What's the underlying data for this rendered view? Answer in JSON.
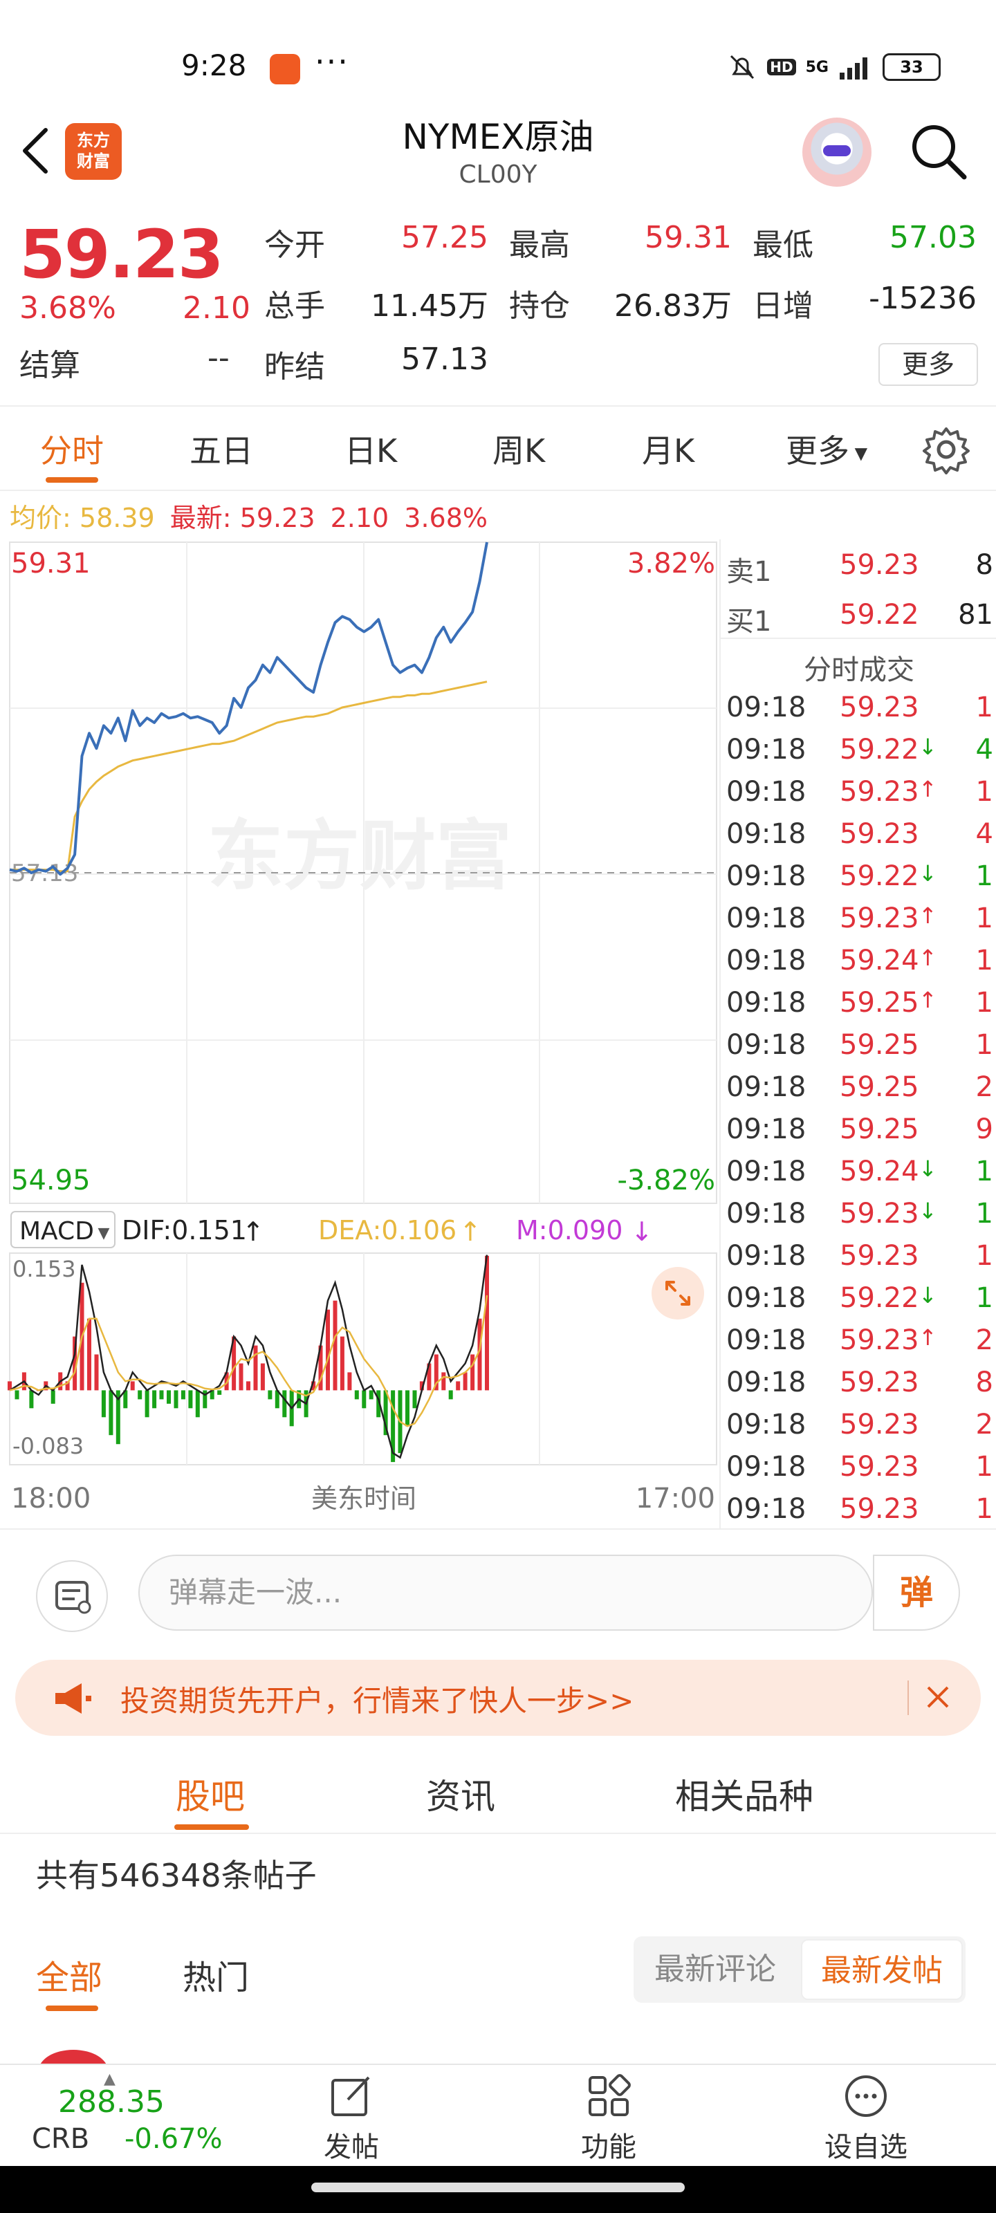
{
  "status": {
    "time": "9:28",
    "dots": "···",
    "net": "5G",
    "hd": "HD",
    "battery": "33"
  },
  "header": {
    "logo_text": "东方\n财富",
    "title": "NYMEX原油",
    "code": "CL00Y"
  },
  "quote": {
    "price": "59.23",
    "change_pct": "3.68%",
    "change": "2.10",
    "settle_label": "结算",
    "settle_value": "--",
    "fields": [
      {
        "label": "今开",
        "value": "57.25",
        "color": "red"
      },
      {
        "label": "最高",
        "value": "59.31",
        "color": "red"
      },
      {
        "label": "最低",
        "value": "57.03",
        "color": "green"
      },
      {
        "label": "总手",
        "value": "11.45万",
        "color": "black"
      },
      {
        "label": "持仓",
        "value": "26.83万",
        "color": "black"
      },
      {
        "label": "日增",
        "value": "-15236",
        "color": "black"
      },
      {
        "label": "昨结",
        "value": "57.13",
        "color": "black"
      }
    ],
    "more_label": "更多"
  },
  "chart_tabs": {
    "items": [
      "分时",
      "五日",
      "日K",
      "周K",
      "月K",
      "更多"
    ],
    "active": "分时"
  },
  "info_line": {
    "avg_label": "均价:",
    "avg_value": "58.39",
    "last_label": "最新:",
    "last_value": "59.23",
    "change": "2.10",
    "change_pct": "3.68%"
  },
  "chart_data": [
    {
      "type": "line",
      "name": "price",
      "ylim": [
        54.95,
        59.31
      ],
      "y_top_label": "59.31",
      "y_bottom_label": "54.95",
      "y_top_pct": "3.82%",
      "y_bottom_pct": "-3.82%",
      "ref_value": 57.13,
      "ref_label": "57.13",
      "watermark": "东方财富",
      "xlabel": "美东时间",
      "x_start": "18:00",
      "x_end": "17:00",
      "series": [
        {
          "values": [
            57.15,
            57.14,
            57.16,
            57.13,
            57.15,
            57.14,
            57.17,
            57.12,
            57.16,
            57.25,
            57.9,
            58.05,
            57.95,
            58.1,
            58.05,
            58.15,
            58.0,
            58.2,
            58.1,
            58.15,
            58.12,
            58.18,
            58.15,
            58.16,
            58.18,
            58.15,
            58.16,
            58.14,
            58.12,
            58.05,
            58.1,
            58.28,
            58.22,
            58.35,
            58.4,
            58.5,
            58.45,
            58.55,
            58.5,
            58.45,
            58.4,
            58.35,
            58.32,
            58.5,
            58.65,
            58.78,
            58.82,
            58.8,
            58.75,
            58.72,
            58.75,
            58.8,
            58.65,
            58.5,
            58.45,
            58.48,
            58.5,
            58.45,
            58.55,
            58.68,
            58.75,
            58.65,
            58.72,
            58.78,
            58.85,
            59.05,
            59.31
          ]
        },
        {
          "values": [
            57.15,
            57.15,
            57.15,
            57.15,
            57.15,
            57.15,
            57.15,
            57.14,
            57.14,
            57.5,
            57.6,
            57.68,
            57.73,
            57.77,
            57.8,
            57.83,
            57.85,
            57.87,
            57.88,
            57.89,
            57.9,
            57.91,
            57.92,
            57.93,
            57.94,
            57.95,
            57.96,
            57.97,
            57.98,
            57.98,
            57.99,
            58.0,
            58.02,
            58.04,
            58.06,
            58.08,
            58.1,
            58.12,
            58.13,
            58.14,
            58.15,
            58.16,
            58.16,
            58.17,
            58.18,
            58.2,
            58.22,
            58.23,
            58.24,
            58.25,
            58.26,
            58.27,
            58.28,
            58.29,
            58.29,
            58.3,
            58.3,
            58.31,
            58.31,
            58.32,
            58.33,
            58.34,
            58.35,
            58.36,
            58.37,
            58.38,
            58.39
          ]
        }
      ]
    },
    {
      "type": "bar",
      "name": "MACD",
      "selector": "MACD",
      "dif": "DIF:0.151",
      "dea": "DEA:0.106",
      "m": "M:0.090",
      "ylim": [
        -0.083,
        0.153
      ],
      "y_top_label": "0.153",
      "y_bottom_label": "-0.083",
      "series": [
        {
          "name": "M",
          "values": [
            0.01,
            -0.01,
            0.02,
            -0.02,
            0.0,
            0.01,
            -0.015,
            0.02,
            0.01,
            0.06,
            0.12,
            0.08,
            0.04,
            -0.03,
            -0.05,
            -0.06,
            -0.02,
            0.01,
            -0.01,
            -0.03,
            -0.02,
            -0.01,
            -0.015,
            -0.02,
            -0.01,
            -0.02,
            -0.03,
            -0.02,
            -0.01,
            -0.005,
            0.02,
            0.06,
            0.03,
            0.01,
            0.05,
            0.03,
            -0.01,
            -0.02,
            -0.03,
            -0.04,
            -0.02,
            -0.03,
            0.01,
            0.05,
            0.09,
            0.1,
            0.06,
            0.02,
            -0.01,
            -0.02,
            -0.01,
            -0.03,
            -0.05,
            -0.08,
            -0.07,
            -0.04,
            -0.02,
            0.01,
            0.03,
            0.04,
            0.02,
            -0.01,
            0.01,
            0.02,
            0.04,
            0.08,
            0.15
          ]
        },
        {
          "name": "DIF",
          "values": [
            0.0,
            0.005,
            0.01,
            0.0,
            -0.005,
            0.005,
            0.0,
            0.01,
            0.015,
            0.04,
            0.14,
            0.11,
            0.07,
            0.02,
            0.0,
            -0.01,
            0.0,
            0.02,
            0.01,
            0.0,
            0.005,
            0.01,
            0.008,
            0.005,
            0.01,
            0.005,
            0.0,
            -0.005,
            0.0,
            0.005,
            0.02,
            0.06,
            0.05,
            0.03,
            0.06,
            0.05,
            0.02,
            0.0,
            -0.01,
            -0.02,
            -0.01,
            -0.015,
            0.01,
            0.05,
            0.1,
            0.12,
            0.09,
            0.05,
            0.02,
            0.0,
            0.005,
            -0.01,
            -0.04,
            -0.07,
            -0.075,
            -0.05,
            -0.03,
            0.0,
            0.03,
            0.05,
            0.035,
            0.01,
            0.02,
            0.03,
            0.05,
            0.09,
            0.151
          ]
        },
        {
          "name": "DEA",
          "values": [
            0.0,
            0.002,
            0.005,
            0.004,
            0.0,
            0.002,
            0.002,
            0.005,
            0.008,
            0.02,
            0.06,
            0.08,
            0.08,
            0.06,
            0.04,
            0.02,
            0.01,
            0.012,
            0.012,
            0.008,
            0.007,
            0.008,
            0.008,
            0.007,
            0.008,
            0.007,
            0.005,
            0.002,
            0.001,
            0.002,
            0.008,
            0.025,
            0.035,
            0.033,
            0.04,
            0.043,
            0.035,
            0.025,
            0.012,
            0.0,
            -0.003,
            -0.006,
            -0.002,
            0.012,
            0.035,
            0.06,
            0.07,
            0.065,
            0.05,
            0.035,
            0.025,
            0.015,
            0.0,
            -0.02,
            -0.035,
            -0.04,
            -0.037,
            -0.025,
            -0.01,
            0.008,
            0.015,
            0.014,
            0.016,
            0.02,
            0.028,
            0.045,
            0.106
          ]
        }
      ]
    }
  ],
  "orderbook": {
    "ask_label": "卖1",
    "ask_price": "59.23",
    "ask_vol": "8",
    "bid_label": "买1",
    "bid_price": "59.22",
    "bid_vol": "81",
    "ticks_title": "分时成交",
    "ticks": [
      {
        "time": "09:18",
        "price": "59.23",
        "arrow": "",
        "vol": "1"
      },
      {
        "time": "09:18",
        "price": "59.22",
        "arrow": "↓",
        "vol": "4"
      },
      {
        "time": "09:18",
        "price": "59.23",
        "arrow": "↑",
        "vol": "1"
      },
      {
        "time": "09:18",
        "price": "59.23",
        "arrow": "",
        "vol": "4"
      },
      {
        "time": "09:18",
        "price": "59.22",
        "arrow": "↓",
        "vol": "1"
      },
      {
        "time": "09:18",
        "price": "59.23",
        "arrow": "↑",
        "vol": "1"
      },
      {
        "time": "09:18",
        "price": "59.24",
        "arrow": "↑",
        "vol": "1"
      },
      {
        "time": "09:18",
        "price": "59.25",
        "arrow": "↑",
        "vol": "1"
      },
      {
        "time": "09:18",
        "price": "59.25",
        "arrow": "",
        "vol": "1"
      },
      {
        "time": "09:18",
        "price": "59.25",
        "arrow": "",
        "vol": "2"
      },
      {
        "time": "09:18",
        "price": "59.25",
        "arrow": "",
        "vol": "9"
      },
      {
        "time": "09:18",
        "price": "59.24",
        "arrow": "↓",
        "vol": "1"
      },
      {
        "time": "09:18",
        "price": "59.23",
        "arrow": "↓",
        "vol": "1"
      },
      {
        "time": "09:18",
        "price": "59.23",
        "arrow": "",
        "vol": "1"
      },
      {
        "time": "09:18",
        "price": "59.22",
        "arrow": "↓",
        "vol": "1"
      },
      {
        "time": "09:18",
        "price": "59.23",
        "arrow": "↑",
        "vol": "2"
      },
      {
        "time": "09:18",
        "price": "59.23",
        "arrow": "",
        "vol": "8"
      },
      {
        "time": "09:18",
        "price": "59.23",
        "arrow": "",
        "vol": "2"
      },
      {
        "time": "09:18",
        "price": "59.23",
        "arrow": "",
        "vol": "1"
      },
      {
        "time": "09:18",
        "price": "59.23",
        "arrow": "",
        "vol": "1"
      }
    ]
  },
  "danmu": {
    "placeholder": "弹幕走一波...",
    "send_label": "弹"
  },
  "banner": {
    "text": "投资期货先开户，行情来了快人一步>>"
  },
  "section_tabs": {
    "items": [
      "股吧",
      "资讯",
      "相关品种"
    ],
    "active": "股吧"
  },
  "post_count": "共有546348条帖子",
  "filters": {
    "items": [
      "全部",
      "热门"
    ],
    "active": "全部",
    "sort_comment": "最新评论",
    "sort_post": "最新发帖"
  },
  "bottom_bar": {
    "crb_value": "288.35",
    "crb_name": "CRB",
    "crb_pct": "-0.67%",
    "items": [
      "发帖",
      "功能",
      "设自选"
    ]
  },
  "colors": {
    "up": "#e0313a",
    "down": "#18a218",
    "accent": "#e86a1a",
    "price_line": "#3a6fb8",
    "avg_line": "#e8b840"
  }
}
